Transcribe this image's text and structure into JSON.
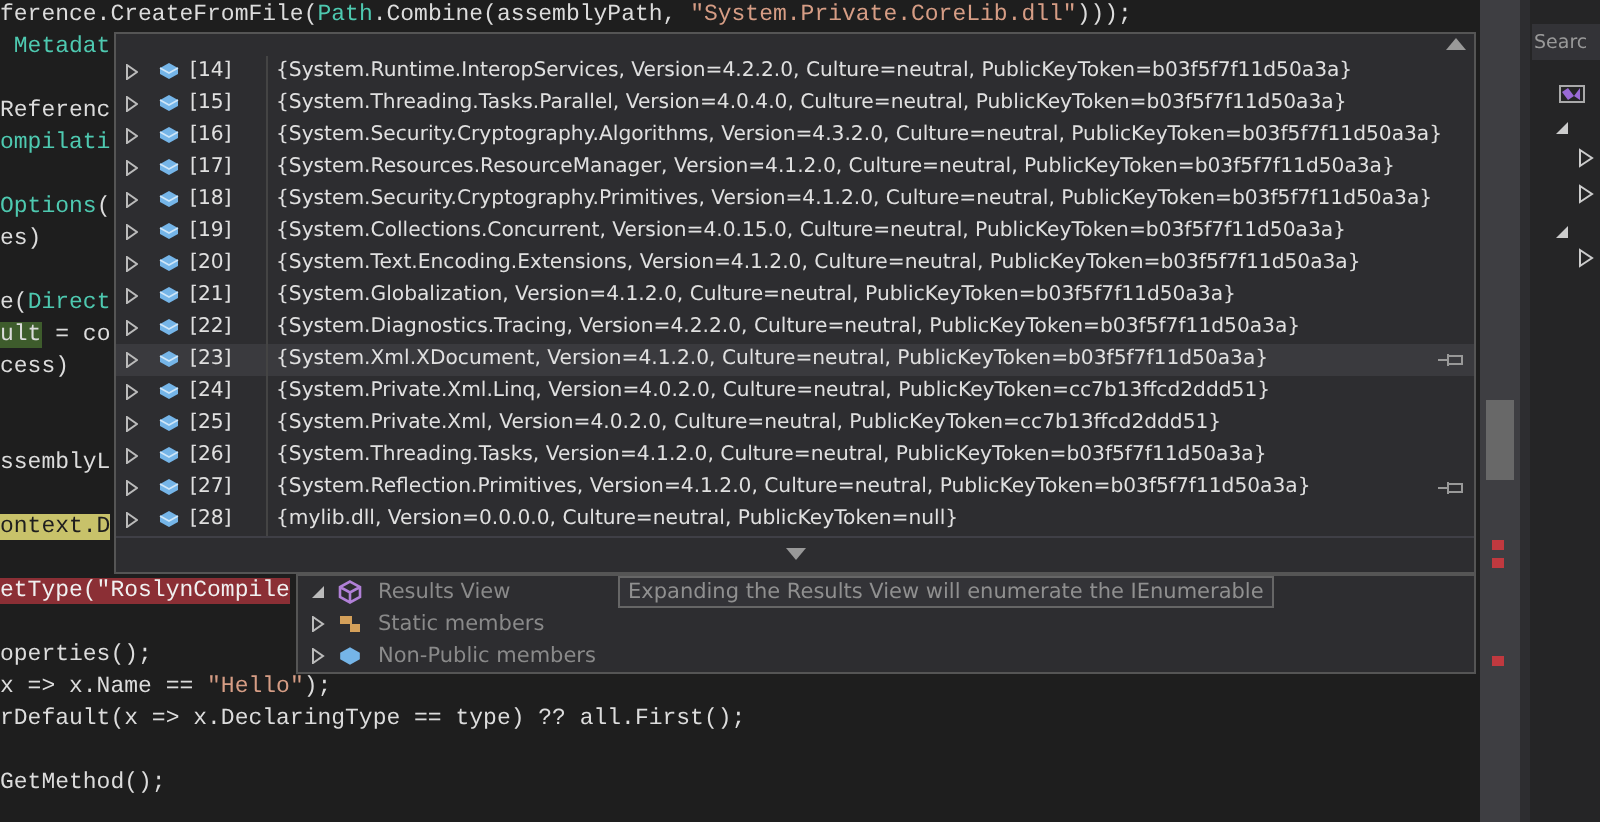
{
  "code_lines": [
    {
      "kind": "code",
      "spans": [
        {
          "kind": "plain",
          "text": "ference.CreateFromFile("
        },
        {
          "kind": "type",
          "text": "Path"
        },
        {
          "kind": "plain",
          "text": ".Combine(assemblyPath, "
        },
        {
          "kind": "string",
          "text": "\"System.Private.CoreLib.dll\""
        },
        {
          "kind": "plain",
          "text": ")));"
        }
      ]
    },
    {
      "kind": "code",
      "spans": [
        {
          "kind": "type",
          "text": " Metadat"
        }
      ]
    },
    {
      "kind": "blank"
    },
    {
      "kind": "code",
      "spans": [
        {
          "kind": "plain",
          "text": "Referenc"
        }
      ]
    },
    {
      "kind": "code",
      "spans": [
        {
          "kind": "type",
          "text": "ompilati"
        }
      ]
    },
    {
      "kind": "blank"
    },
    {
      "kind": "code",
      "spans": [
        {
          "kind": "type",
          "text": "Options"
        },
        {
          "kind": "plain",
          "text": "("
        }
      ]
    },
    {
      "kind": "code",
      "spans": [
        {
          "kind": "plain",
          "text": "es)"
        }
      ]
    },
    {
      "kind": "blank"
    },
    {
      "kind": "code",
      "spans": [
        {
          "kind": "plain",
          "text": "e("
        },
        {
          "kind": "type",
          "text": "Direct"
        }
      ]
    },
    {
      "kind": "code",
      "spans": [
        {
          "kind": "hl_green",
          "text": "ult"
        },
        {
          "kind": "plain",
          "text": " = co"
        }
      ]
    },
    {
      "kind": "code",
      "spans": [
        {
          "kind": "plain",
          "text": "cess)"
        }
      ]
    },
    {
      "kind": "blank"
    },
    {
      "kind": "blank"
    },
    {
      "kind": "code",
      "spans": [
        {
          "kind": "plain",
          "text": "ssemblyL"
        }
      ]
    },
    {
      "kind": "blank"
    },
    {
      "kind": "code",
      "spans": [
        {
          "kind": "hl_yellow",
          "text": "ontext.D"
        }
      ]
    },
    {
      "kind": "blank"
    },
    {
      "kind": "breakpoint",
      "spans": [
        {
          "text": "etType(\"RoslynCompile"
        }
      ]
    },
    {
      "kind": "blank"
    },
    {
      "kind": "code",
      "spans": [
        {
          "kind": "plain",
          "text": "operties();"
        }
      ]
    },
    {
      "kind": "code",
      "spans": [
        {
          "kind": "plain",
          "text": "x => x.Name == "
        },
        {
          "kind": "string",
          "text": "\"Hello\""
        },
        {
          "kind": "plain",
          "text": ");"
        }
      ]
    },
    {
      "kind": "code",
      "spans": [
        {
          "kind": "plain",
          "text": "rDefault(x => x.DeclaringType == type) ?? all.First();"
        }
      ]
    },
    {
      "kind": "blank"
    },
    {
      "kind": "code",
      "spans": [
        {
          "kind": "plain",
          "text": "GetMethod();"
        }
      ]
    }
  ],
  "datatip": {
    "rows": [
      {
        "index": "[14]",
        "value": "{System.Runtime.InteropServices, Version=4.2.2.0, Culture=neutral, PublicKeyToken=b03f5f7f11d50a3a}",
        "hovered": false,
        "pin_icon": false
      },
      {
        "index": "[15]",
        "value": "{System.Threading.Tasks.Parallel, Version=4.0.4.0, Culture=neutral, PublicKeyToken=b03f5f7f11d50a3a}",
        "hovered": false,
        "pin_icon": false
      },
      {
        "index": "[16]",
        "value": "{System.Security.Cryptography.Algorithms, Version=4.3.2.0, Culture=neutral, PublicKeyToken=b03f5f7f11d50a3a}",
        "hovered": false,
        "pin_icon": false
      },
      {
        "index": "[17]",
        "value": "{System.Resources.ResourceManager, Version=4.1.2.0, Culture=neutral, PublicKeyToken=b03f5f7f11d50a3a}",
        "hovered": false,
        "pin_icon": false
      },
      {
        "index": "[18]",
        "value": "{System.Security.Cryptography.Primitives, Version=4.1.2.0, Culture=neutral, PublicKeyToken=b03f5f7f11d50a3a}",
        "hovered": false,
        "pin_icon": false
      },
      {
        "index": "[19]",
        "value": "{System.Collections.Concurrent, Version=4.0.15.0, Culture=neutral, PublicKeyToken=b03f5f7f11d50a3a}",
        "hovered": false,
        "pin_icon": false
      },
      {
        "index": "[20]",
        "value": "{System.Text.Encoding.Extensions, Version=4.1.2.0, Culture=neutral, PublicKeyToken=b03f5f7f11d50a3a}",
        "hovered": false,
        "pin_icon": false
      },
      {
        "index": "[21]",
        "value": "{System.Globalization, Version=4.1.2.0, Culture=neutral, PublicKeyToken=b03f5f7f11d50a3a}",
        "hovered": false,
        "pin_icon": false
      },
      {
        "index": "[22]",
        "value": "{System.Diagnostics.Tracing, Version=4.2.2.0, Culture=neutral, PublicKeyToken=b03f5f7f11d50a3a}",
        "hovered": false,
        "pin_icon": false
      },
      {
        "index": "[23]",
        "value": "{System.Xml.XDocument, Version=4.1.2.0, Culture=neutral, PublicKeyToken=b03f5f7f11d50a3a}",
        "hovered": true,
        "pin_icon": true
      },
      {
        "index": "[24]",
        "value": "{System.Private.Xml.Linq, Version=4.0.2.0, Culture=neutral, PublicKeyToken=cc7b13ffcd2ddd51}",
        "hovered": false,
        "pin_icon": false
      },
      {
        "index": "[25]",
        "value": "{System.Private.Xml, Version=4.0.2.0, Culture=neutral, PublicKeyToken=cc7b13ffcd2ddd51}",
        "hovered": false,
        "pin_icon": false
      },
      {
        "index": "[26]",
        "value": "{System.Threading.Tasks, Version=4.1.2.0, Culture=neutral, PublicKeyToken=b03f5f7f11d50a3a}",
        "hovered": false,
        "pin_icon": false
      },
      {
        "index": "[27]",
        "value": "{System.Reflection.Primitives, Version=4.1.2.0, Culture=neutral, PublicKeyToken=b03f5f7f11d50a3a}",
        "hovered": false,
        "pin_icon": true
      },
      {
        "index": "[28]",
        "value": "{mylib.dll, Version=0.0.0.0, Culture=neutral, PublicKeyToken=null}",
        "hovered": false,
        "pin_icon": false
      }
    ]
  },
  "members": [
    {
      "kind": "results",
      "label": "Results View",
      "expanded": true,
      "value": "Expanding the Results View will enumerate the IEnumerable"
    },
    {
      "kind": "static",
      "label": "Static members",
      "expanded": false
    },
    {
      "kind": "nonpublic",
      "label": "Non-Public members",
      "expanded": false
    }
  ],
  "side_panel": {
    "search": {
      "placeholder": "Searc"
    }
  }
}
